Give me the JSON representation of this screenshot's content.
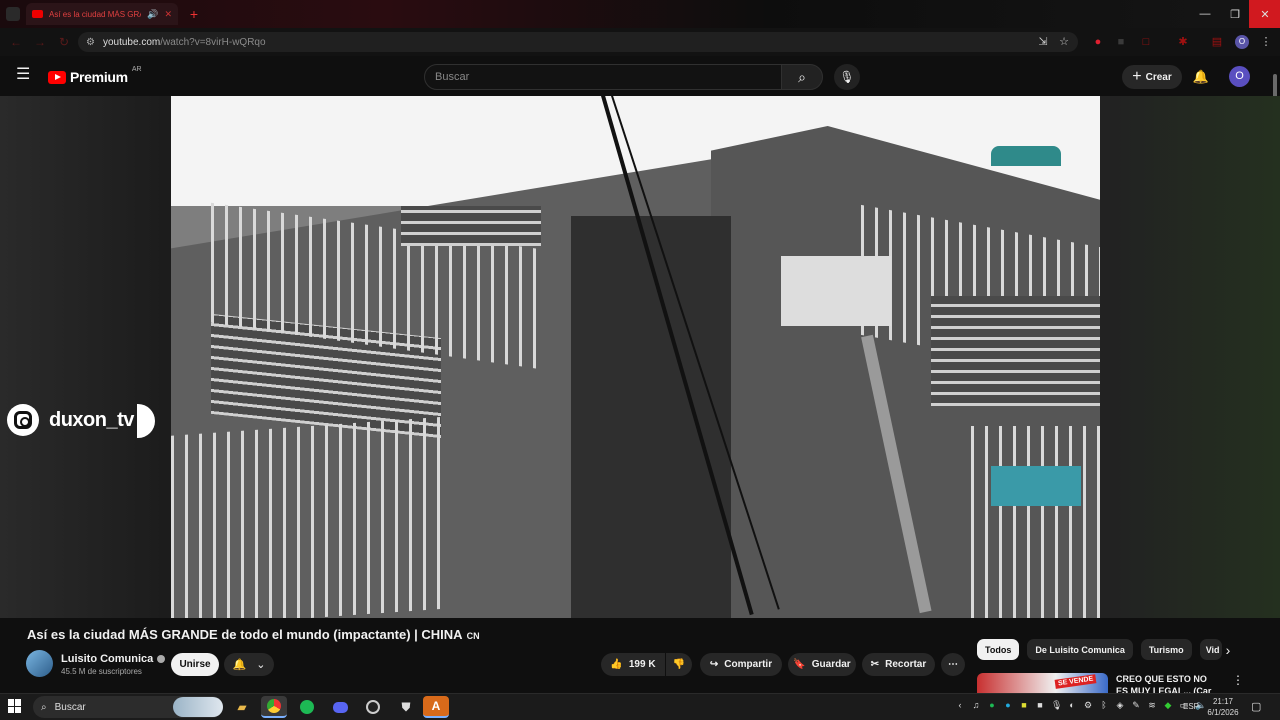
{
  "browser": {
    "tab_title": "Así es la ciudad MÁS GRAN",
    "new_tab": "+",
    "url_host": "youtube.com",
    "url_path": "/watch?v=8virH-wQRqo",
    "profile_initial": "O",
    "window_controls": {
      "minimize": "—",
      "restore": "❐",
      "close": "✕"
    }
  },
  "header": {
    "logo_text": "Premium",
    "country_code": "AR",
    "search_placeholder": "Buscar",
    "create_label": "Crear",
    "avatar_initial": "O"
  },
  "player": {
    "watermark_handle": "duxon_tv"
  },
  "video": {
    "title": "Así es la ciudad MÁS GRANDE de todo el mundo (impactante) | CHINA",
    "title_flag": "CN",
    "channel_name": "Luisito Comunica",
    "subscribers": "45.5 M de suscriptores",
    "join_label": "Unirse",
    "likes": "199 K",
    "share_label": "Compartir",
    "save_label": "Guardar",
    "clip_label": "Recortar"
  },
  "sidebar": {
    "chips": [
      "Todos",
      "De Luisito Comunica",
      "Turismo",
      "Vid"
    ],
    "rec_title": "CREO QUE ESTO NO ES MUY LEGAL... (Car Deals",
    "rec_thumb_tag": "SE VENDE"
  },
  "taskbar": {
    "search_label": "Buscar",
    "language": "ESP",
    "time": "21:17",
    "date": "6/1/2026"
  },
  "colors": {
    "youtube_red": "#ff0000",
    "background": "#0f0f0f",
    "pill": "#272727",
    "avatar": "#5a4fc0"
  }
}
